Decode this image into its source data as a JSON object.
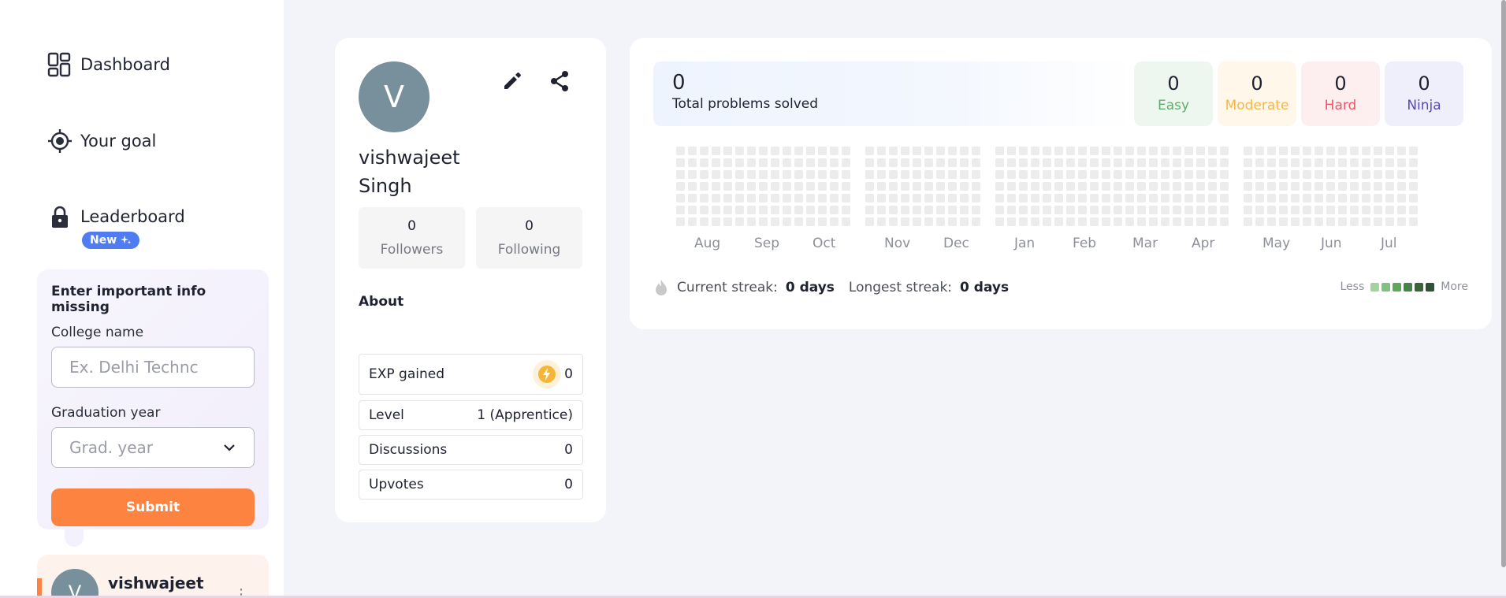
{
  "sidebar": {
    "nav": [
      {
        "label": "Dashboard",
        "icon": "dashboard-icon"
      },
      {
        "label": "Your goal",
        "icon": "target-icon"
      },
      {
        "label": "Leaderboard",
        "icon": "lock-icon"
      }
    ],
    "new_badge": "New",
    "info_card": {
      "title": "Enter important info missing",
      "college_label": "College name",
      "college_placeholder": "Ex. Delhi Technc",
      "grad_label": "Graduation year",
      "grad_placeholder": "Grad. year",
      "submit": "Submit"
    },
    "user": {
      "initial": "V",
      "name": "vishwajeet"
    }
  },
  "profile": {
    "initial": "V",
    "name": "vishwajeet Singh",
    "followers": {
      "count": "0",
      "label": "Followers"
    },
    "following": {
      "count": "0",
      "label": "Following"
    },
    "about_label": "About",
    "exp": {
      "label": "EXP gained",
      "value": "0"
    },
    "level": {
      "label": "Level",
      "value": "1 (Apprentice)"
    },
    "discussions": {
      "label": "Discussions",
      "value": "0"
    },
    "upvotes": {
      "label": "Upvotes",
      "value": "0"
    }
  },
  "stats": {
    "total": {
      "value": "0",
      "label": "Total problems solved"
    },
    "difficulty": [
      {
        "value": "0",
        "label": "Easy",
        "bg": "#eef7ef",
        "color": "#5cae6c"
      },
      {
        "value": "0",
        "label": "Moderate",
        "bg": "#fef7ea",
        "color": "#f9b646"
      },
      {
        "value": "0",
        "label": "Hard",
        "bg": "#fdeef0",
        "color": "#ec5864"
      },
      {
        "value": "0",
        "label": "Ninja",
        "bg": "#efeffb",
        "color": "#5b48b3"
      }
    ],
    "months": [
      "Aug",
      "Sep",
      "Oct",
      "Nov",
      "Dec",
      "Jan",
      "Feb",
      "Mar",
      "Apr",
      "May",
      "Jun",
      "Jul"
    ],
    "current_streak_label": "Current streak:",
    "current_streak_value": "0 days",
    "longest_streak_label": "Longest streak:",
    "longest_streak_value": "0 days",
    "legend_less": "Less",
    "legend_more": "More",
    "legend_colors": [
      "#a4d3a2",
      "#82c27f",
      "#5da85b",
      "#46854a",
      "#37663a",
      "#2f5134"
    ]
  }
}
